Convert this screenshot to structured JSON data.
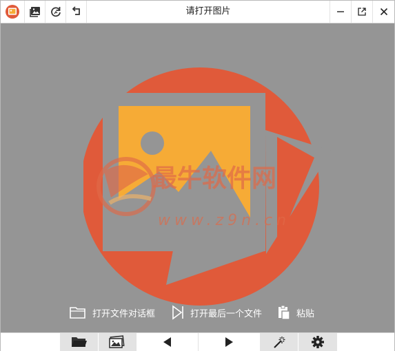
{
  "window": {
    "title": "请打开图片"
  },
  "actions": {
    "open_dialog": "打开文件对话框",
    "open_last": "打开最后一个文件",
    "paste": "粘贴"
  },
  "watermark": {
    "brand": "最牛软件网",
    "url": "www.z9n.cn"
  },
  "colors": {
    "background": "#959595",
    "logo_circle": "#e05a3a",
    "logo_picture": "#f6ab36",
    "watermark": "#e06a48"
  },
  "icons": {
    "app": "app-logo-icon",
    "gallery": "image-gallery-icon",
    "rotate": "refresh-icon",
    "undo": "undo-icon",
    "minimize": "minimize-icon",
    "popout": "popout-icon",
    "close": "close-icon",
    "folder": "folder-icon",
    "image_collection": "image-collection-icon",
    "prev": "previous-icon",
    "next": "next-icon",
    "magic": "magic-wand-icon",
    "settings": "gear-icon"
  }
}
